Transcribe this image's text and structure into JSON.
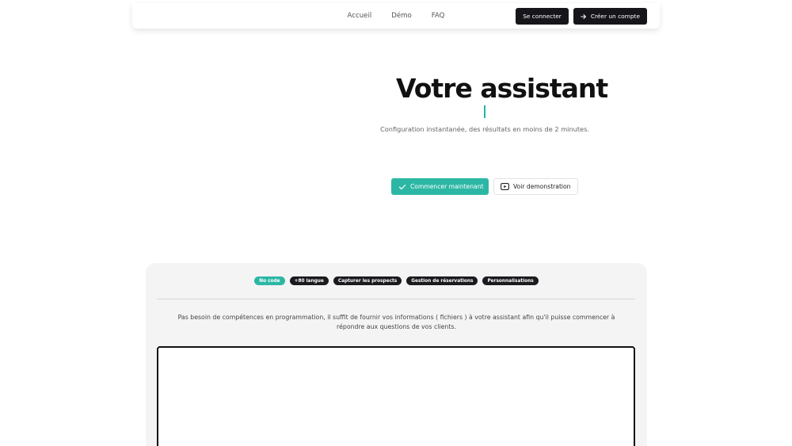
{
  "nav": {
    "links": [
      "Accueil",
      "Démo",
      "FAQ"
    ],
    "login_label": "Se connecter",
    "signup_label": "Créer un compte"
  },
  "hero": {
    "title": "Votre assistant",
    "subtitle": "Configuration instantanée, des résultats en moins de 2 minutes.",
    "primary_cta": "Commencer maintenant",
    "secondary_cta": "Voir demonstration"
  },
  "features": {
    "tags": [
      {
        "label": "No code",
        "active": true
      },
      {
        "label": "+80 langue",
        "active": false
      },
      {
        "label": "Capturer les prospects",
        "active": false
      },
      {
        "label": "Gestion de réservations",
        "active": false
      },
      {
        "label": "Personnalisations",
        "active": false
      }
    ],
    "description_line1": "Pas besoin de compétences en programmation, il suffit de fournir vos informations ( fichiers ) à votre assistant afin qu'il puisse commencer à",
    "description_line2": "répondre aux questions de vos clients."
  },
  "colors": {
    "accent": "#2cb7a5",
    "dark": "#16161a",
    "panel_bg": "#f4f4f5"
  },
  "icons": {
    "signup": "arrow-right-icon",
    "primary_cta": "check-icon",
    "secondary_cta": "play-icon"
  }
}
